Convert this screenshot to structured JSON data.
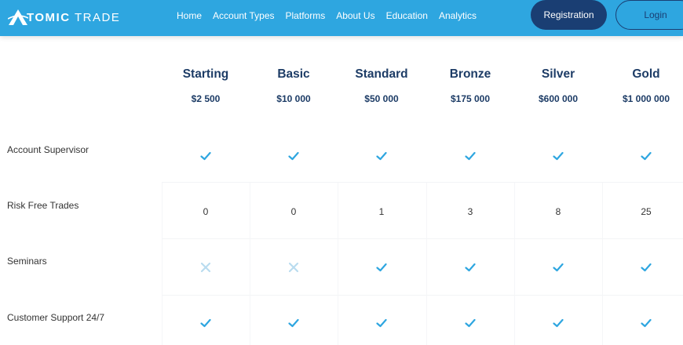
{
  "header": {
    "logo": {
      "bold": "TOMIC",
      "light": "TRADE"
    },
    "nav": [
      "Home",
      "Account Types",
      "Platforms",
      "About Us",
      "Education",
      "Analytics"
    ],
    "register_label": "Registration",
    "login_label": "Login",
    "colors": {
      "bar": "#2ea6e0",
      "primary_dark": "#1a3e73"
    }
  },
  "plans": [
    {
      "name": "Starting",
      "price": "$2 500"
    },
    {
      "name": "Basic",
      "price": "$10 000"
    },
    {
      "name": "Standard",
      "price": "$50 000"
    },
    {
      "name": "Bronze",
      "price": "$175 000"
    },
    {
      "name": "Silver",
      "price": "$600 000"
    },
    {
      "name": "Gold",
      "price": "$1 000 000"
    }
  ],
  "features": [
    {
      "label": "Account Supervisor",
      "values": [
        "check",
        "check",
        "check",
        "check",
        "check",
        "check"
      ]
    },
    {
      "label": "Risk Free Trades",
      "values": [
        "0",
        "0",
        "1",
        "3",
        "8",
        "25"
      ]
    },
    {
      "label": "Seminars",
      "values": [
        "cross",
        "cross",
        "check",
        "check",
        "check",
        "check"
      ]
    },
    {
      "label": "Customer Support 24/7",
      "values": [
        "check",
        "check",
        "check",
        "check",
        "check",
        "check"
      ]
    }
  ],
  "icon_colors": {
    "check": "#2ea6e0",
    "cross": "#b9dcef"
  }
}
